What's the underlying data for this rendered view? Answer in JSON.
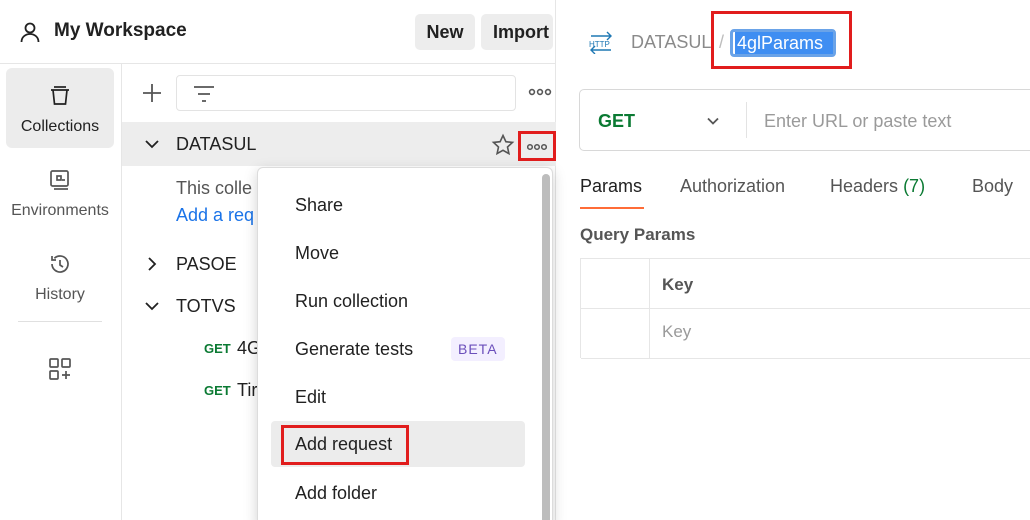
{
  "workspace": {
    "title": "My Workspace",
    "new_label": "New",
    "import_label": "Import"
  },
  "rail": {
    "items": [
      {
        "label": "Collections",
        "icon": "collections-icon",
        "active": true
      },
      {
        "label": "Environments",
        "icon": "environments-icon",
        "active": false
      },
      {
        "label": "History",
        "icon": "history-icon",
        "active": false
      }
    ]
  },
  "tree": {
    "collections": [
      {
        "name": "DATASUL",
        "expanded": true,
        "empty_text": "This colle",
        "add_request_link": "Add a req"
      },
      {
        "name": "PASOE",
        "expanded": false
      },
      {
        "name": "TOTVS",
        "expanded": true,
        "requests": [
          {
            "method": "GET",
            "name": "4G"
          },
          {
            "method": "GET",
            "name": "Tir"
          }
        ]
      }
    ]
  },
  "context_menu": {
    "items": [
      "Share",
      "Move",
      "Run collection",
      "Generate tests",
      "Edit",
      "Add request",
      "Add folder"
    ],
    "beta_badge": "BETA",
    "hovered": "Add request"
  },
  "request": {
    "breadcrumb_collection": "DATASUL",
    "breadcrumb_separator": "/",
    "name": "4glParams",
    "method": "GET",
    "url_placeholder": "Enter URL or paste text",
    "tabs": [
      "Params",
      "Authorization",
      "Headers",
      "Body"
    ],
    "headers_count": "(7)",
    "active_tab": "Params",
    "query_params_title": "Query Params",
    "table_key_header": "Key",
    "table_key_placeholder": "Key"
  },
  "colors": {
    "accent_orange": "#ff6c37",
    "get_green": "#0b7a33",
    "highlight_red": "#e11d1d",
    "selection_blue": "#3f8ef2",
    "link_blue": "#1a73e8"
  }
}
